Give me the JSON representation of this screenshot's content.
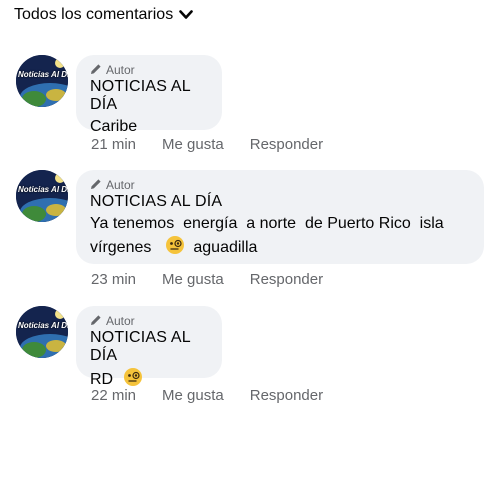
{
  "header": {
    "sort_label": "Todos los comentarios"
  },
  "avatar_text": "Noticias Al Día",
  "comments": [
    {
      "badge": "Autor",
      "author": "NOTICIAS AL DÍA",
      "text_lines": [
        "Caribe"
      ],
      "time": "21 min",
      "like": "Me gusta",
      "reply": "Responder"
    },
    {
      "badge": "Autor",
      "author": "NOTICIAS AL DÍA",
      "text_lines": [
        "Ya tenemos  energía  a norte  de Puerto Rico  isla",
        "vírgenes",
        "aguadilla"
      ],
      "time": "23 min",
      "like": "Me gusta",
      "reply": "Responder"
    },
    {
      "badge": "Autor",
      "author": "NOTICIAS AL DÍA",
      "text_lines": [
        "RD"
      ],
      "time": "22 min",
      "like": "Me gusta",
      "reply": "Responder"
    }
  ],
  "icons": {
    "badge": "pencil-icon",
    "sort": "chevron-down-icon",
    "emoji": "face-with-monocle-emoji"
  },
  "colors": {
    "bubble": "#f0f2f5",
    "secondary_text": "#65676b",
    "primary_text": "#050505"
  }
}
